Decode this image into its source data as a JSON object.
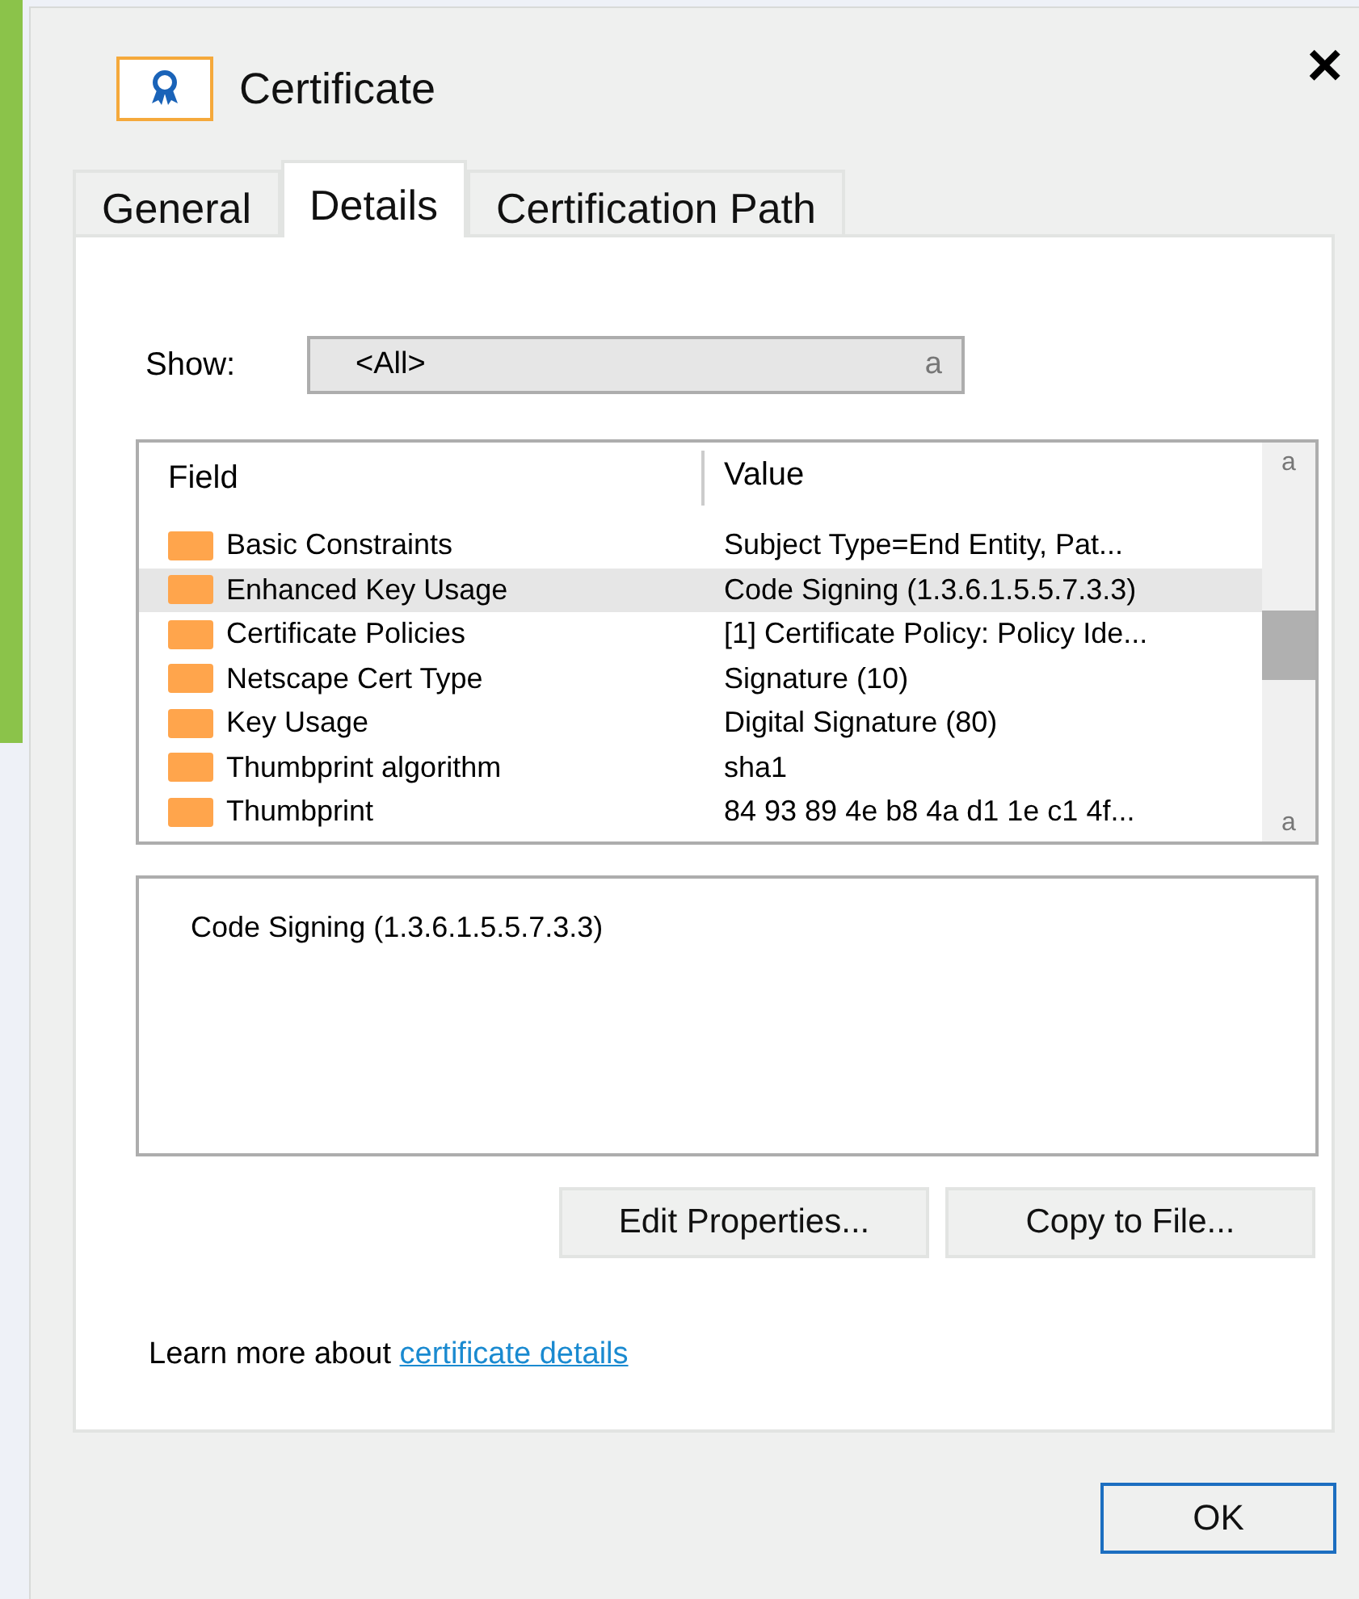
{
  "window": {
    "title": "Certificate",
    "close": "×"
  },
  "tabs": [
    {
      "label": "General",
      "selected": false
    },
    {
      "label": "Details",
      "selected": true
    },
    {
      "label": "Certification Path",
      "selected": false
    }
  ],
  "show": {
    "label": "Show:",
    "value": "<All>",
    "arrow": "a"
  },
  "table": {
    "columns": [
      "Field",
      "Value"
    ],
    "scroll_up": "a",
    "scroll_down": "a",
    "rows": [
      {
        "field": "Basic Constraints",
        "value": "Subject Type=End Entity, Pat...",
        "selected": false
      },
      {
        "field": "Enhanced Key Usage",
        "value": "Code Signing (1.3.6.1.5.5.7.3.3)",
        "selected": true
      },
      {
        "field": "Certificate Policies",
        "value": "[1] Certificate Policy: Policy Ide...",
        "selected": false
      },
      {
        "field": "Netscape Cert Type",
        "value": "Signature (10)",
        "selected": false
      },
      {
        "field": "Key Usage",
        "value": "Digital Signature (80)",
        "selected": false
      },
      {
        "field": "Thumbprint algorithm",
        "value": "sha1",
        "selected": false
      },
      {
        "field": "Thumbprint",
        "value": "84 93 89 4e b8 4a d1 1e c1 4f...",
        "selected": false
      }
    ]
  },
  "detail": "Code Signing (1.3.6.1.5.5.7.3.3)",
  "buttons": [
    "Edit Properties...",
    "Copy to File..."
  ],
  "learn_more": {
    "text": "Learn more about",
    "link": "certificate details"
  },
  "ok": "OK"
}
